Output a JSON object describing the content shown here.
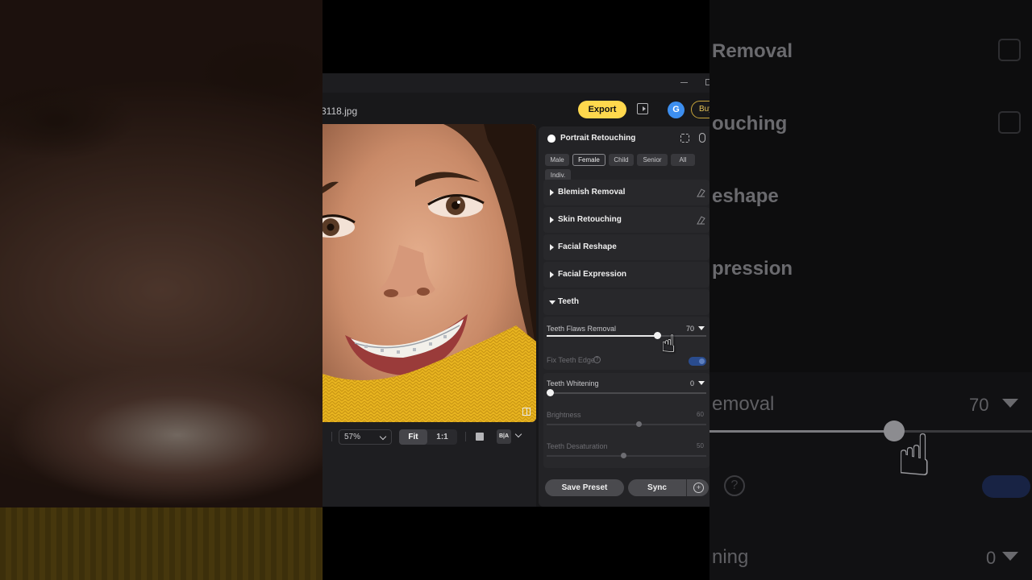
{
  "window": {
    "filename": "3118.jpg",
    "export_label": "Export",
    "avatar_initial": "G",
    "buy_label": "Buy"
  },
  "canvas": {
    "zoom_value": "57%",
    "fit_label": "Fit",
    "actual_label": "1:1",
    "before_after_label": "B|A"
  },
  "panel": {
    "title": "Portrait Retouching",
    "chips": [
      "Male",
      "Female",
      "Child",
      "Senior",
      "All",
      "Indiv."
    ],
    "active_chip": "Female",
    "sections": [
      {
        "label": "Blemish Removal",
        "expanded": false
      },
      {
        "label": "Skin Retouching",
        "expanded": false
      },
      {
        "label": "Facial Reshape",
        "expanded": false
      },
      {
        "label": "Facial Expression",
        "expanded": false
      },
      {
        "label": "Teeth",
        "expanded": true
      }
    ],
    "teeth": {
      "flaws_label": "Teeth Flaws Removal",
      "flaws_value": "70",
      "fix_edge_label": "Fix Teeth Edge",
      "fix_edge_on": true,
      "whitening_label": "Teeth Whitening",
      "whitening_value": "0",
      "brightness_label": "Brightness",
      "brightness_value": "60",
      "desaturation_label": "Teeth Desaturation",
      "desaturation_value": "50"
    },
    "save_preset_label": "Save Preset",
    "sync_label": "Sync"
  },
  "zoomed_view": {
    "texts": [
      "Removal",
      "ouching",
      "eshape",
      "pression",
      "emoval",
      "ning"
    ],
    "flaws_value": "70",
    "whitening_value": "0"
  },
  "colors": {
    "accent_yellow": "#ffd84d",
    "avatar_blue": "#3d8ff0",
    "toggle_blue": "#2a4c8e",
    "panel_bg": "#232326"
  }
}
